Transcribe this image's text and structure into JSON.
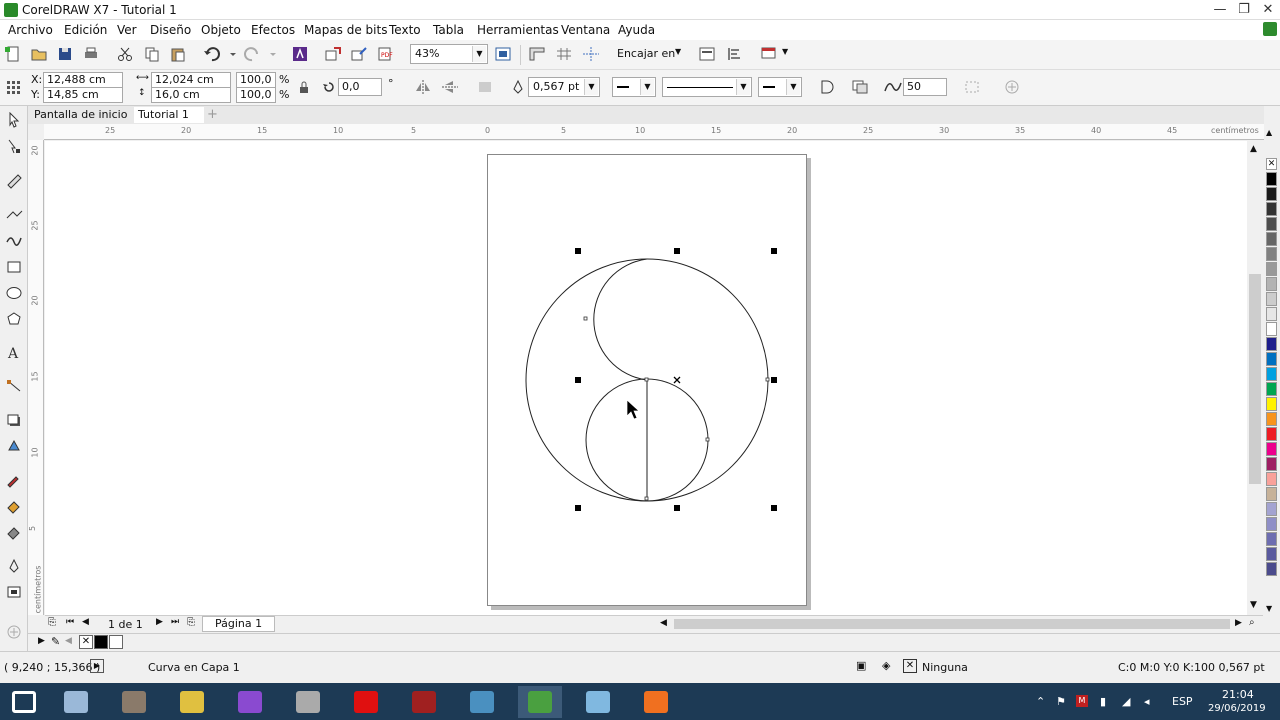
{
  "window": {
    "title": "CorelDRAW X7 - Tutorial 1",
    "minimize": "—",
    "restore": "❐",
    "close": "✕"
  },
  "menu": [
    {
      "label": "Archivo"
    },
    {
      "label": "Edición"
    },
    {
      "label": "Ver"
    },
    {
      "label": "Diseño"
    },
    {
      "label": "Objeto"
    },
    {
      "label": "Efectos"
    },
    {
      "label": "Mapas de bits"
    },
    {
      "label": "Texto"
    },
    {
      "label": "Tabla"
    },
    {
      "label": "Herramientas"
    },
    {
      "label": "Ventana"
    },
    {
      "label": "Ayuda"
    }
  ],
  "toolbar": {
    "zoom": "43%",
    "snap_label": "Encajar en"
  },
  "properties": {
    "x_label": "X:",
    "x_value": "12,488 cm",
    "y_label": "Y:",
    "y_value": "14,85 cm",
    "w_value": "12,024 cm",
    "h_value": "16,0 cm",
    "scale_w": "100,0",
    "scale_h": "100,0",
    "percent": "%",
    "rotation": "0,0",
    "degree": "°",
    "outline_width": "0,567 pt",
    "smoothing": "50"
  },
  "doc_tabs": [
    {
      "label": "Pantalla de inicio"
    },
    {
      "label": "Tutorial 1"
    }
  ],
  "ruler": {
    "unit": "centímetros",
    "h_labels": [
      "25",
      "20",
      "15",
      "10",
      "5",
      "0",
      "5",
      "10",
      "15",
      "20",
      "25",
      "30",
      "35",
      "40",
      "45"
    ],
    "v_labels": [
      "20",
      "25",
      "20",
      "15",
      "10",
      "5"
    ]
  },
  "page_nav": {
    "counter": "1 de 1",
    "page_tab": "Página 1"
  },
  "status": {
    "coords": "( 9,240 ; 15,366 )",
    "object_info": "Curva en Capa 1",
    "fill_label": "Ninguna",
    "outline_info": "C:0 M:0 Y:0 K:100  0,567 pt"
  },
  "colors": {
    "accent": "#2a8a2a",
    "taskbar": "#1d3a55",
    "palette": [
      "#000000",
      "#1a1a1a",
      "#333333",
      "#4d4d4d",
      "#666666",
      "#808080",
      "#999999",
      "#b3b3b3",
      "#cccccc",
      "#e6e6e6",
      "#ffffff",
      "#1e1e8c",
      "#0070c0",
      "#00a0e0",
      "#00a651",
      "#fff200",
      "#f7941d",
      "#ed1c24",
      "#ec008c",
      "#9e1f63",
      "#f9a19a",
      "#c7b299",
      "#a3a3d1",
      "#8f8fc7",
      "#6d6db0",
      "#5a5a9e",
      "#4b4b8c"
    ]
  },
  "taskbar": {
    "apps": [
      {
        "icon": "windows-start-icon",
        "color": "#ffffff"
      },
      {
        "icon": "file-explorer-icon",
        "color": "#9ab8d8"
      },
      {
        "icon": "brick-wall-icon",
        "color": "#8a7a6a"
      },
      {
        "icon": "paint-app-icon",
        "color": "#e0c040"
      },
      {
        "icon": "visual-studio-icon",
        "color": "#8a4ad0"
      },
      {
        "icon": "m-app-icon",
        "color": "#aaaaaa"
      },
      {
        "icon": "opera-icon",
        "color": "#e01010"
      },
      {
        "icon": "dota-icon",
        "color": "#a02020"
      },
      {
        "icon": "steam-icon",
        "color": "#4a90c0"
      },
      {
        "icon": "coreldraw-icon",
        "color": "#4aa040"
      },
      {
        "icon": "window-app-icon",
        "color": "#80b8e0"
      },
      {
        "icon": "orange-app-icon",
        "color": "#f07020"
      }
    ],
    "language": "ESP",
    "time": "21:04",
    "date": "29/06/2019"
  }
}
